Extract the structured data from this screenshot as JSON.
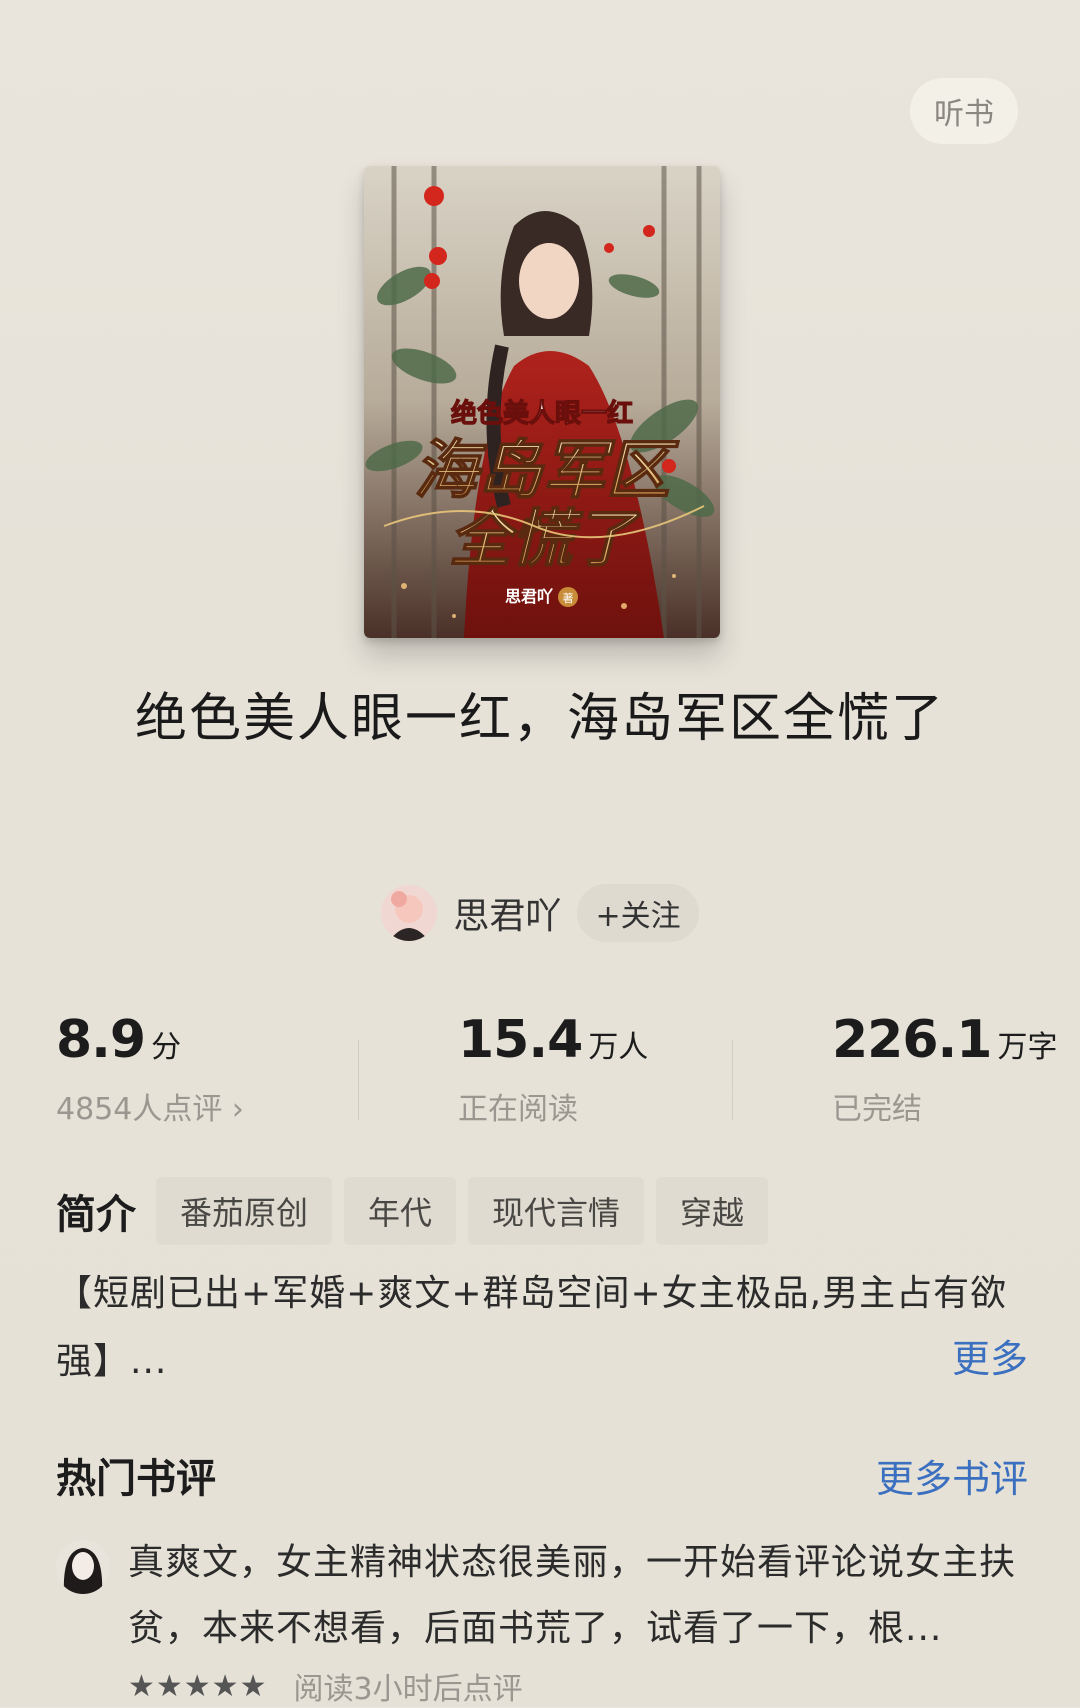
{
  "header": {
    "listen_label": "听书"
  },
  "cover": {
    "title_line_small": "绝色美人眼一红",
    "title_line_big_1": "海岛军区",
    "title_line_big_2": "全慌了",
    "author_mark": "思君吖",
    "author_suffix": "著"
  },
  "book": {
    "title": "绝色美人眼一红，海岛军区全慌了",
    "author": "思君吖",
    "follow_label": "+关注"
  },
  "stats": {
    "rating": {
      "value": "8.9",
      "unit": "分",
      "sub": "4854人点评 ›"
    },
    "readers": {
      "value": "15.4",
      "unit": "万人",
      "sub": "正在阅读"
    },
    "words": {
      "value": "226.1",
      "unit": "万字",
      "sub": "已完结"
    }
  },
  "intro": {
    "label": "简介",
    "tags": [
      "番茄原创",
      "年代",
      "现代言情",
      "穿越"
    ],
    "summary": "【短剧已出+军婚+爽文+群岛空间+女主极品,男主占有欲强】...",
    "more_label": "更多"
  },
  "reviews": {
    "title": "热门书评",
    "more_label": "更多书评",
    "items": [
      {
        "text": "真爽文，女主精神状态很美丽，一开始看评论说女主扶贫，本来不想看，后面书荒了，试看了一下，根...",
        "stars": "★★★★★",
        "meta": "阅读3小时后点评"
      }
    ]
  },
  "colors": {
    "accent_link": "#3b6fbf",
    "cover_red": "#8e1a16",
    "gold": "#e8c57a"
  },
  "icons": {
    "chevron": "chevron-right-icon",
    "star": "star-icon"
  }
}
